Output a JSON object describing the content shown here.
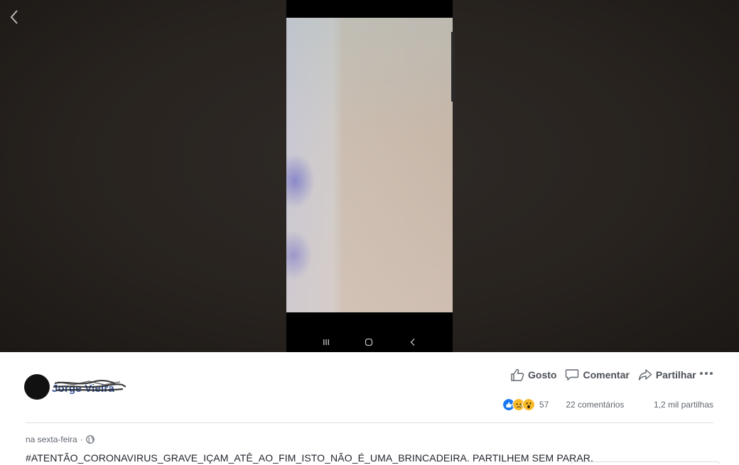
{
  "viewer": {
    "back_icon": "chevron-left-icon",
    "phone_nav_icons": [
      "recent-apps-icon",
      "home-icon",
      "android-back-icon"
    ]
  },
  "post": {
    "author_name": "Jorge Vieira",
    "actions": [
      {
        "label": "Gosto",
        "icon": "thumbs-up-icon"
      },
      {
        "label": "Comentar",
        "icon": "comment-icon"
      },
      {
        "label": "Partilhar",
        "icon": "share-icon"
      }
    ],
    "more_icon": "more-options-icon",
    "reactions": {
      "icons": [
        "like-reaction-icon",
        "sad-reaction-icon",
        "wow-reaction-icon"
      ],
      "count": "57"
    },
    "comments_count": "22 comentários",
    "shares_count": "1,2 mil partilhas",
    "timestamp": "na sexta-feira",
    "audience_icon": "globe-icon",
    "text": "#ATENTÃO_CORONAVIRUS_GRAVE_IÇAM_ATÊ_AO_FIM_ISTO_NÃO_É_UMA_BRINCADEIRA. PARTILHEM SEM PARAR."
  },
  "colors": {
    "link_blue": "#3b5998",
    "like_blue": "#1877f2",
    "reaction_yellow": "#f7b928",
    "text_gray": "#606770"
  }
}
